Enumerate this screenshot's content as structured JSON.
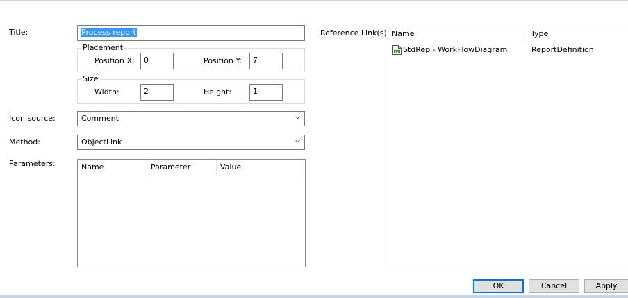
{
  "form": {
    "title_label": "Title:",
    "title_value": "Process report",
    "placement": {
      "label": "Placement",
      "position_x_label": "Position X:",
      "position_x_value": "0",
      "position_y_label": "Position Y:",
      "position_y_value": "7"
    },
    "size": {
      "label": "Size",
      "width_label": "Width:",
      "width_value": "2",
      "height_label": "Height:",
      "height_value": "1"
    },
    "icon_source_label": "Icon source:",
    "icon_source_value": "Comment",
    "method_label": "Method:",
    "method_value": "ObjectLink",
    "parameters_label": "Parameters:",
    "parameters_columns": [
      "Name",
      "Parameter",
      "Value"
    ]
  },
  "reference_links": {
    "label": "Reference Link(s):",
    "columns": [
      "Name",
      "Type"
    ],
    "rows": [
      {
        "name": "StdRep - WorkFlowDiagram",
        "type": "ReportDefinition",
        "icon": "report-document-icon"
      }
    ]
  },
  "buttons": {
    "ok": "OK",
    "cancel": "Cancel",
    "apply": "Apply"
  }
}
